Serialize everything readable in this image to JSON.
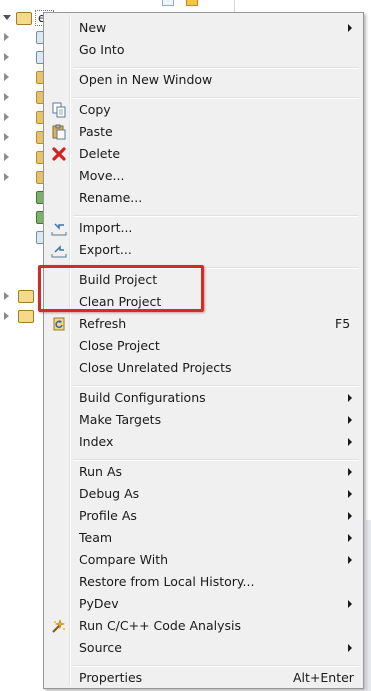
{
  "tree": {
    "project_label": "e"
  },
  "menu": {
    "items": [
      {
        "label": "New",
        "submenu": true
      },
      {
        "label": "Go Into"
      },
      {
        "label": "Open in New Window"
      },
      {
        "label": "Copy",
        "icon": "copy-icon"
      },
      {
        "label": "Paste",
        "icon": "paste-icon"
      },
      {
        "label": "Delete",
        "icon": "delete-icon"
      },
      {
        "label": "Move..."
      },
      {
        "label": "Rename..."
      },
      {
        "label": "Import...",
        "icon": "import-icon"
      },
      {
        "label": "Export...",
        "icon": "export-icon"
      },
      {
        "label": "Build Project"
      },
      {
        "label": "Clean Project"
      },
      {
        "label": "Refresh",
        "accelerator": "F5",
        "icon": "refresh-icon"
      },
      {
        "label": "Close Project"
      },
      {
        "label": "Close Unrelated Projects"
      },
      {
        "label": "Build Configurations",
        "submenu": true
      },
      {
        "label": "Make Targets",
        "submenu": true
      },
      {
        "label": "Index",
        "submenu": true
      },
      {
        "label": "Run As",
        "submenu": true
      },
      {
        "label": "Debug As",
        "submenu": true
      },
      {
        "label": "Profile As",
        "submenu": true
      },
      {
        "label": "Team",
        "submenu": true
      },
      {
        "label": "Compare With",
        "submenu": true
      },
      {
        "label": "Restore from Local History..."
      },
      {
        "label": "PyDev",
        "submenu": true
      },
      {
        "label": "Run C/C++ Code Analysis",
        "icon": "code-analysis-icon"
      },
      {
        "label": "Source",
        "submenu": true
      },
      {
        "label": "Properties",
        "accelerator": "Alt+Enter"
      }
    ]
  },
  "colors": {
    "highlight": "#d42a2a",
    "menu_bg": "#f0f0f0"
  }
}
